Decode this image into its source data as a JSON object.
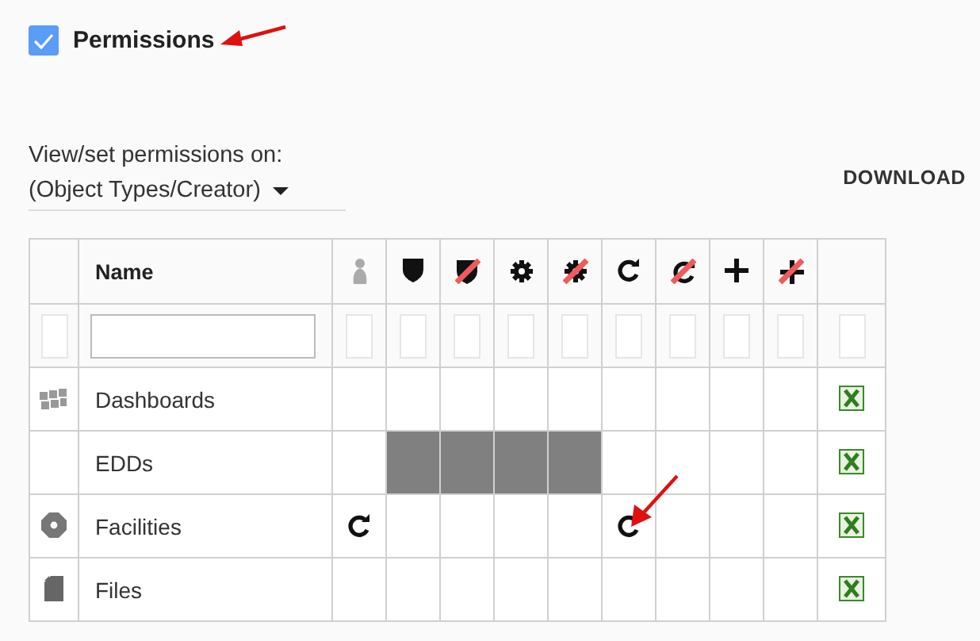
{
  "permissions": {
    "label": "Permissions",
    "checked": true
  },
  "view_selector": {
    "label": "View/set permissions on:",
    "value": "(Object Types/Creator)"
  },
  "download_button": "DOWNLOAD",
  "table": {
    "name_header": "Name",
    "permission_columns": [
      {
        "kind": "user"
      },
      {
        "kind": "shield"
      },
      {
        "kind": "shield-denied"
      },
      {
        "kind": "gear"
      },
      {
        "kind": "gear-denied"
      },
      {
        "kind": "refresh"
      },
      {
        "kind": "refresh-denied"
      },
      {
        "kind": "plus"
      },
      {
        "kind": "plus-denied"
      }
    ],
    "rows": [
      {
        "kind": "dashboard",
        "name": "Dashboards",
        "cells": [
          {
            "kind": "empty"
          },
          {
            "kind": "empty"
          },
          {
            "kind": "empty"
          },
          {
            "kind": "empty"
          },
          {
            "kind": "empty"
          },
          {
            "kind": "empty"
          },
          {
            "kind": "empty"
          },
          {
            "kind": "empty"
          },
          {
            "kind": "empty"
          }
        ]
      },
      {
        "kind": "plain",
        "name": "EDDs",
        "cells": [
          {
            "kind": "empty"
          },
          {
            "kind": "blocked"
          },
          {
            "kind": "blocked"
          },
          {
            "kind": "blocked"
          },
          {
            "kind": "blocked"
          },
          {
            "kind": "empty"
          },
          {
            "kind": "empty"
          },
          {
            "kind": "empty"
          },
          {
            "kind": "empty"
          }
        ]
      },
      {
        "kind": "facility",
        "name": "Facilities",
        "cells": [
          {
            "kind": "refresh"
          },
          {
            "kind": "empty"
          },
          {
            "kind": "empty"
          },
          {
            "kind": "empty"
          },
          {
            "kind": "empty"
          },
          {
            "kind": "refresh"
          },
          {
            "kind": "empty"
          },
          {
            "kind": "empty"
          },
          {
            "kind": "empty"
          }
        ]
      },
      {
        "kind": "file",
        "name": "Files",
        "cells": [
          {
            "kind": "empty"
          },
          {
            "kind": "empty"
          },
          {
            "kind": "empty"
          },
          {
            "kind": "empty"
          },
          {
            "kind": "empty"
          },
          {
            "kind": "empty"
          },
          {
            "kind": "empty"
          },
          {
            "kind": "empty"
          },
          {
            "kind": "empty"
          }
        ]
      }
    ]
  }
}
